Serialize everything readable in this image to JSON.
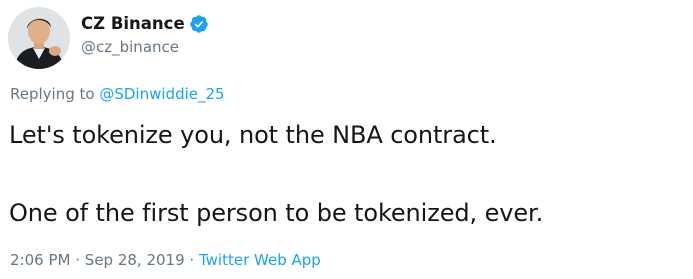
{
  "tweet": {
    "display_name": "CZ Binance",
    "handle": "@cz_binance",
    "reply_prefix": "Replying to",
    "reply_to": "@SDinwiddie_25",
    "text_line_1": "Let's tokenize you, not the NBA contract.",
    "text_line_2": "One of the first person to be tokenized, ever.",
    "time": "2:06 PM",
    "separator": "·",
    "date": "Sep 28, 2019",
    "source": "Twitter Web App"
  },
  "colors": {
    "text": "#14171a",
    "secondary": "#657786",
    "link": "#1da1f2",
    "verified": "#1da1f2"
  },
  "icons": {
    "avatar": "profile-photo",
    "verified": "verified-badge-icon"
  }
}
